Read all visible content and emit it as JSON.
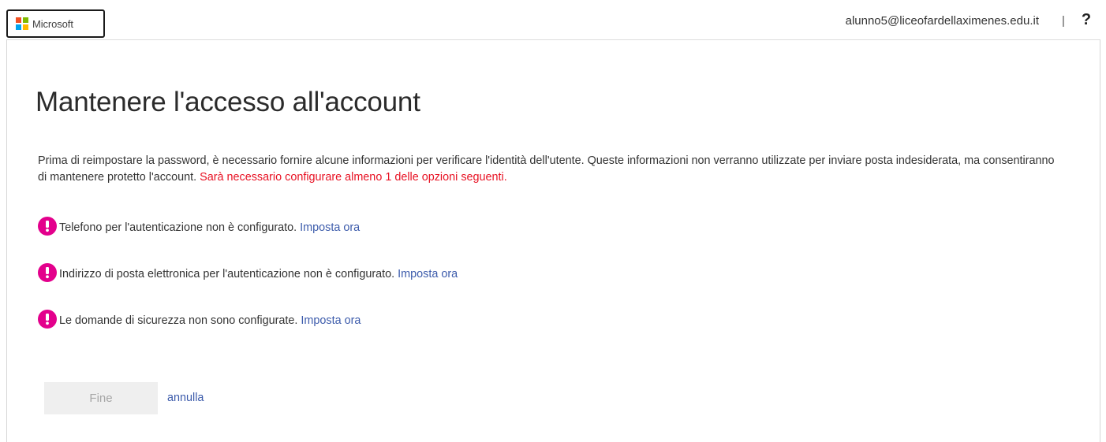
{
  "header": {
    "logo_text": "Microsoft",
    "logo_colors": [
      "#f25022",
      "#7fba00",
      "#00a4ef",
      "#ffb900"
    ],
    "user_email": "alunno5@liceofardellaximenes.edu.it",
    "separator": "|",
    "help_label": "?"
  },
  "main": {
    "title": "Mantenere l'accesso all'account",
    "intro_text": "Prima di reimpostare la password, è necessario fornire alcune informazioni per verificare l'identità dell'utente. Queste informazioni non verranno utilizzate per inviare posta indesiderata, ma consentiranno di mantenere protetto l'account.",
    "intro_warning": "Sarà necessario configurare almeno 1 delle opzioni seguenti.",
    "items": [
      {
        "icon": "exclamation-circle-icon",
        "text": "Telefono per l'autenticazione non è configurato.",
        "link": "Imposta ora"
      },
      {
        "icon": "exclamation-circle-icon",
        "text": "Indirizzo di posta elettronica per l'autenticazione non è configurato.",
        "link": "Imposta ora"
      },
      {
        "icon": "exclamation-circle-icon",
        "text": "Le domande di sicurezza non sono configurate.",
        "link": "Imposta ora"
      }
    ],
    "finish_button": "Fine",
    "cancel_link": "annulla"
  },
  "colors": {
    "warning": "#e81123",
    "alert_icon": "#e3008c",
    "link": "#3c5bab",
    "disabled_button_bg": "#efefef",
    "disabled_button_text": "#a6a6a6"
  }
}
